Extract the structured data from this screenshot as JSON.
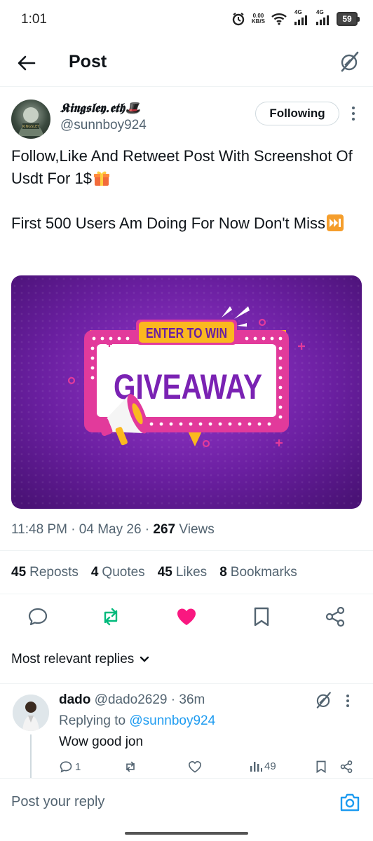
{
  "status_bar": {
    "time": "1:01",
    "net_speed": "0.00",
    "net_unit": "KB/S",
    "network_1": "4G",
    "network_2": "4G",
    "battery": "59"
  },
  "header": {
    "title": "Post",
    "back_icon": "arrow-left-icon",
    "grok_icon": "grok-icon"
  },
  "author": {
    "name": "𝕶𝖎𝖓𝖌𝖘𝖑𝖊𝖞.𝖊𝖙𝖍🎩",
    "handle": "@sunnboy924",
    "follow_label": "Following"
  },
  "post": {
    "line1": "Follow,Like And Retweet Post With Screenshot Of Usdt For 1$",
    "line2": "First 500 Users Am Doing For Now Don't Miss",
    "image": {
      "badge": "ENTER TO WIN",
      "headline": "GIVEAWAY"
    },
    "meta_time": "11:48 PM · 04 May 26 · ",
    "meta_views_count": "267",
    "meta_views_label": " Views"
  },
  "stats": [
    {
      "count": "45",
      "label": "Reposts"
    },
    {
      "count": "4",
      "label": "Quotes"
    },
    {
      "count": "45",
      "label": "Likes"
    },
    {
      "count": "8",
      "label": "Bookmarks"
    }
  ],
  "actions": {
    "reply_icon": "reply-icon",
    "repost_icon": "repost-icon",
    "like_icon": "heart-icon",
    "bookmark_icon": "bookmark-icon",
    "share_icon": "share-icon",
    "repost_color": "#00ba7c",
    "like_color": "#f91880"
  },
  "replies_sort": {
    "label": "Most relevant replies"
  },
  "reply": {
    "name": "dado",
    "handle_time": " @dado2629 · 36m",
    "replying_prefix": "Replying to ",
    "replying_to": "@sunnboy924",
    "text": "Wow good jon",
    "reply_count": "1",
    "views": "49"
  },
  "composer": {
    "placeholder": "Post your reply"
  },
  "colors": {
    "accent": "#1d9bf0",
    "muted": "#536471",
    "purple": "#6a1fa0",
    "yellow": "#fbb81f"
  }
}
